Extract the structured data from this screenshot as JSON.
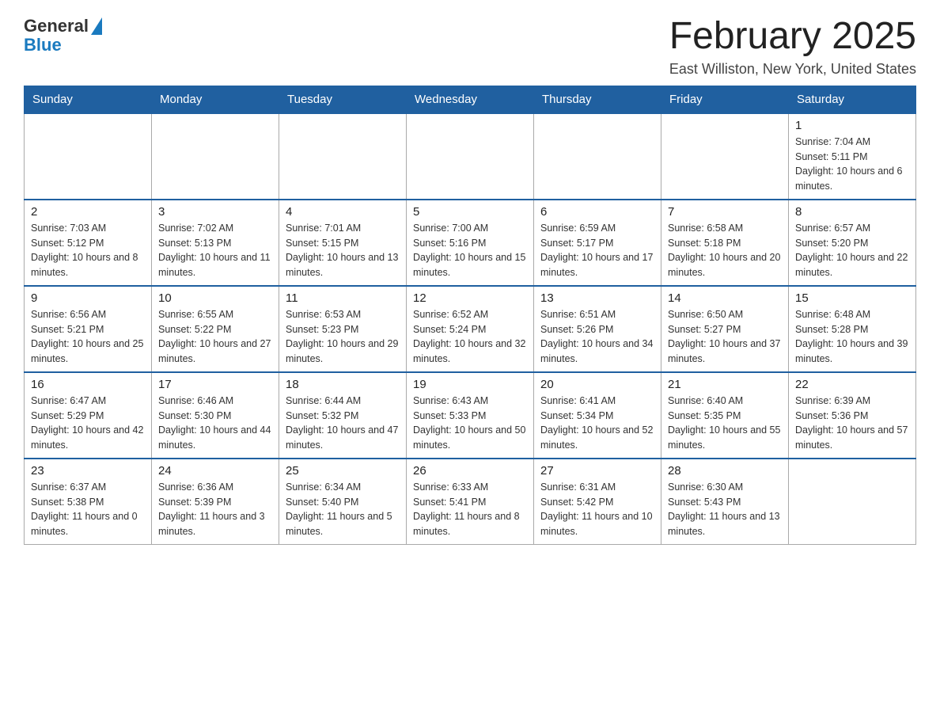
{
  "header": {
    "logo_general": "General",
    "logo_blue": "Blue",
    "month_title": "February 2025",
    "location": "East Williston, New York, United States"
  },
  "days_of_week": [
    "Sunday",
    "Monday",
    "Tuesday",
    "Wednesday",
    "Thursday",
    "Friday",
    "Saturday"
  ],
  "weeks": [
    [
      {
        "day": "",
        "info": ""
      },
      {
        "day": "",
        "info": ""
      },
      {
        "day": "",
        "info": ""
      },
      {
        "day": "",
        "info": ""
      },
      {
        "day": "",
        "info": ""
      },
      {
        "day": "",
        "info": ""
      },
      {
        "day": "1",
        "info": "Sunrise: 7:04 AM\nSunset: 5:11 PM\nDaylight: 10 hours and 6 minutes."
      }
    ],
    [
      {
        "day": "2",
        "info": "Sunrise: 7:03 AM\nSunset: 5:12 PM\nDaylight: 10 hours and 8 minutes."
      },
      {
        "day": "3",
        "info": "Sunrise: 7:02 AM\nSunset: 5:13 PM\nDaylight: 10 hours and 11 minutes."
      },
      {
        "day": "4",
        "info": "Sunrise: 7:01 AM\nSunset: 5:15 PM\nDaylight: 10 hours and 13 minutes."
      },
      {
        "day": "5",
        "info": "Sunrise: 7:00 AM\nSunset: 5:16 PM\nDaylight: 10 hours and 15 minutes."
      },
      {
        "day": "6",
        "info": "Sunrise: 6:59 AM\nSunset: 5:17 PM\nDaylight: 10 hours and 17 minutes."
      },
      {
        "day": "7",
        "info": "Sunrise: 6:58 AM\nSunset: 5:18 PM\nDaylight: 10 hours and 20 minutes."
      },
      {
        "day": "8",
        "info": "Sunrise: 6:57 AM\nSunset: 5:20 PM\nDaylight: 10 hours and 22 minutes."
      }
    ],
    [
      {
        "day": "9",
        "info": "Sunrise: 6:56 AM\nSunset: 5:21 PM\nDaylight: 10 hours and 25 minutes."
      },
      {
        "day": "10",
        "info": "Sunrise: 6:55 AM\nSunset: 5:22 PM\nDaylight: 10 hours and 27 minutes."
      },
      {
        "day": "11",
        "info": "Sunrise: 6:53 AM\nSunset: 5:23 PM\nDaylight: 10 hours and 29 minutes."
      },
      {
        "day": "12",
        "info": "Sunrise: 6:52 AM\nSunset: 5:24 PM\nDaylight: 10 hours and 32 minutes."
      },
      {
        "day": "13",
        "info": "Sunrise: 6:51 AM\nSunset: 5:26 PM\nDaylight: 10 hours and 34 minutes."
      },
      {
        "day": "14",
        "info": "Sunrise: 6:50 AM\nSunset: 5:27 PM\nDaylight: 10 hours and 37 minutes."
      },
      {
        "day": "15",
        "info": "Sunrise: 6:48 AM\nSunset: 5:28 PM\nDaylight: 10 hours and 39 minutes."
      }
    ],
    [
      {
        "day": "16",
        "info": "Sunrise: 6:47 AM\nSunset: 5:29 PM\nDaylight: 10 hours and 42 minutes."
      },
      {
        "day": "17",
        "info": "Sunrise: 6:46 AM\nSunset: 5:30 PM\nDaylight: 10 hours and 44 minutes."
      },
      {
        "day": "18",
        "info": "Sunrise: 6:44 AM\nSunset: 5:32 PM\nDaylight: 10 hours and 47 minutes."
      },
      {
        "day": "19",
        "info": "Sunrise: 6:43 AM\nSunset: 5:33 PM\nDaylight: 10 hours and 50 minutes."
      },
      {
        "day": "20",
        "info": "Sunrise: 6:41 AM\nSunset: 5:34 PM\nDaylight: 10 hours and 52 minutes."
      },
      {
        "day": "21",
        "info": "Sunrise: 6:40 AM\nSunset: 5:35 PM\nDaylight: 10 hours and 55 minutes."
      },
      {
        "day": "22",
        "info": "Sunrise: 6:39 AM\nSunset: 5:36 PM\nDaylight: 10 hours and 57 minutes."
      }
    ],
    [
      {
        "day": "23",
        "info": "Sunrise: 6:37 AM\nSunset: 5:38 PM\nDaylight: 11 hours and 0 minutes."
      },
      {
        "day": "24",
        "info": "Sunrise: 6:36 AM\nSunset: 5:39 PM\nDaylight: 11 hours and 3 minutes."
      },
      {
        "day": "25",
        "info": "Sunrise: 6:34 AM\nSunset: 5:40 PM\nDaylight: 11 hours and 5 minutes."
      },
      {
        "day": "26",
        "info": "Sunrise: 6:33 AM\nSunset: 5:41 PM\nDaylight: 11 hours and 8 minutes."
      },
      {
        "day": "27",
        "info": "Sunrise: 6:31 AM\nSunset: 5:42 PM\nDaylight: 11 hours and 10 minutes."
      },
      {
        "day": "28",
        "info": "Sunrise: 6:30 AM\nSunset: 5:43 PM\nDaylight: 11 hours and 13 minutes."
      },
      {
        "day": "",
        "info": ""
      }
    ]
  ]
}
